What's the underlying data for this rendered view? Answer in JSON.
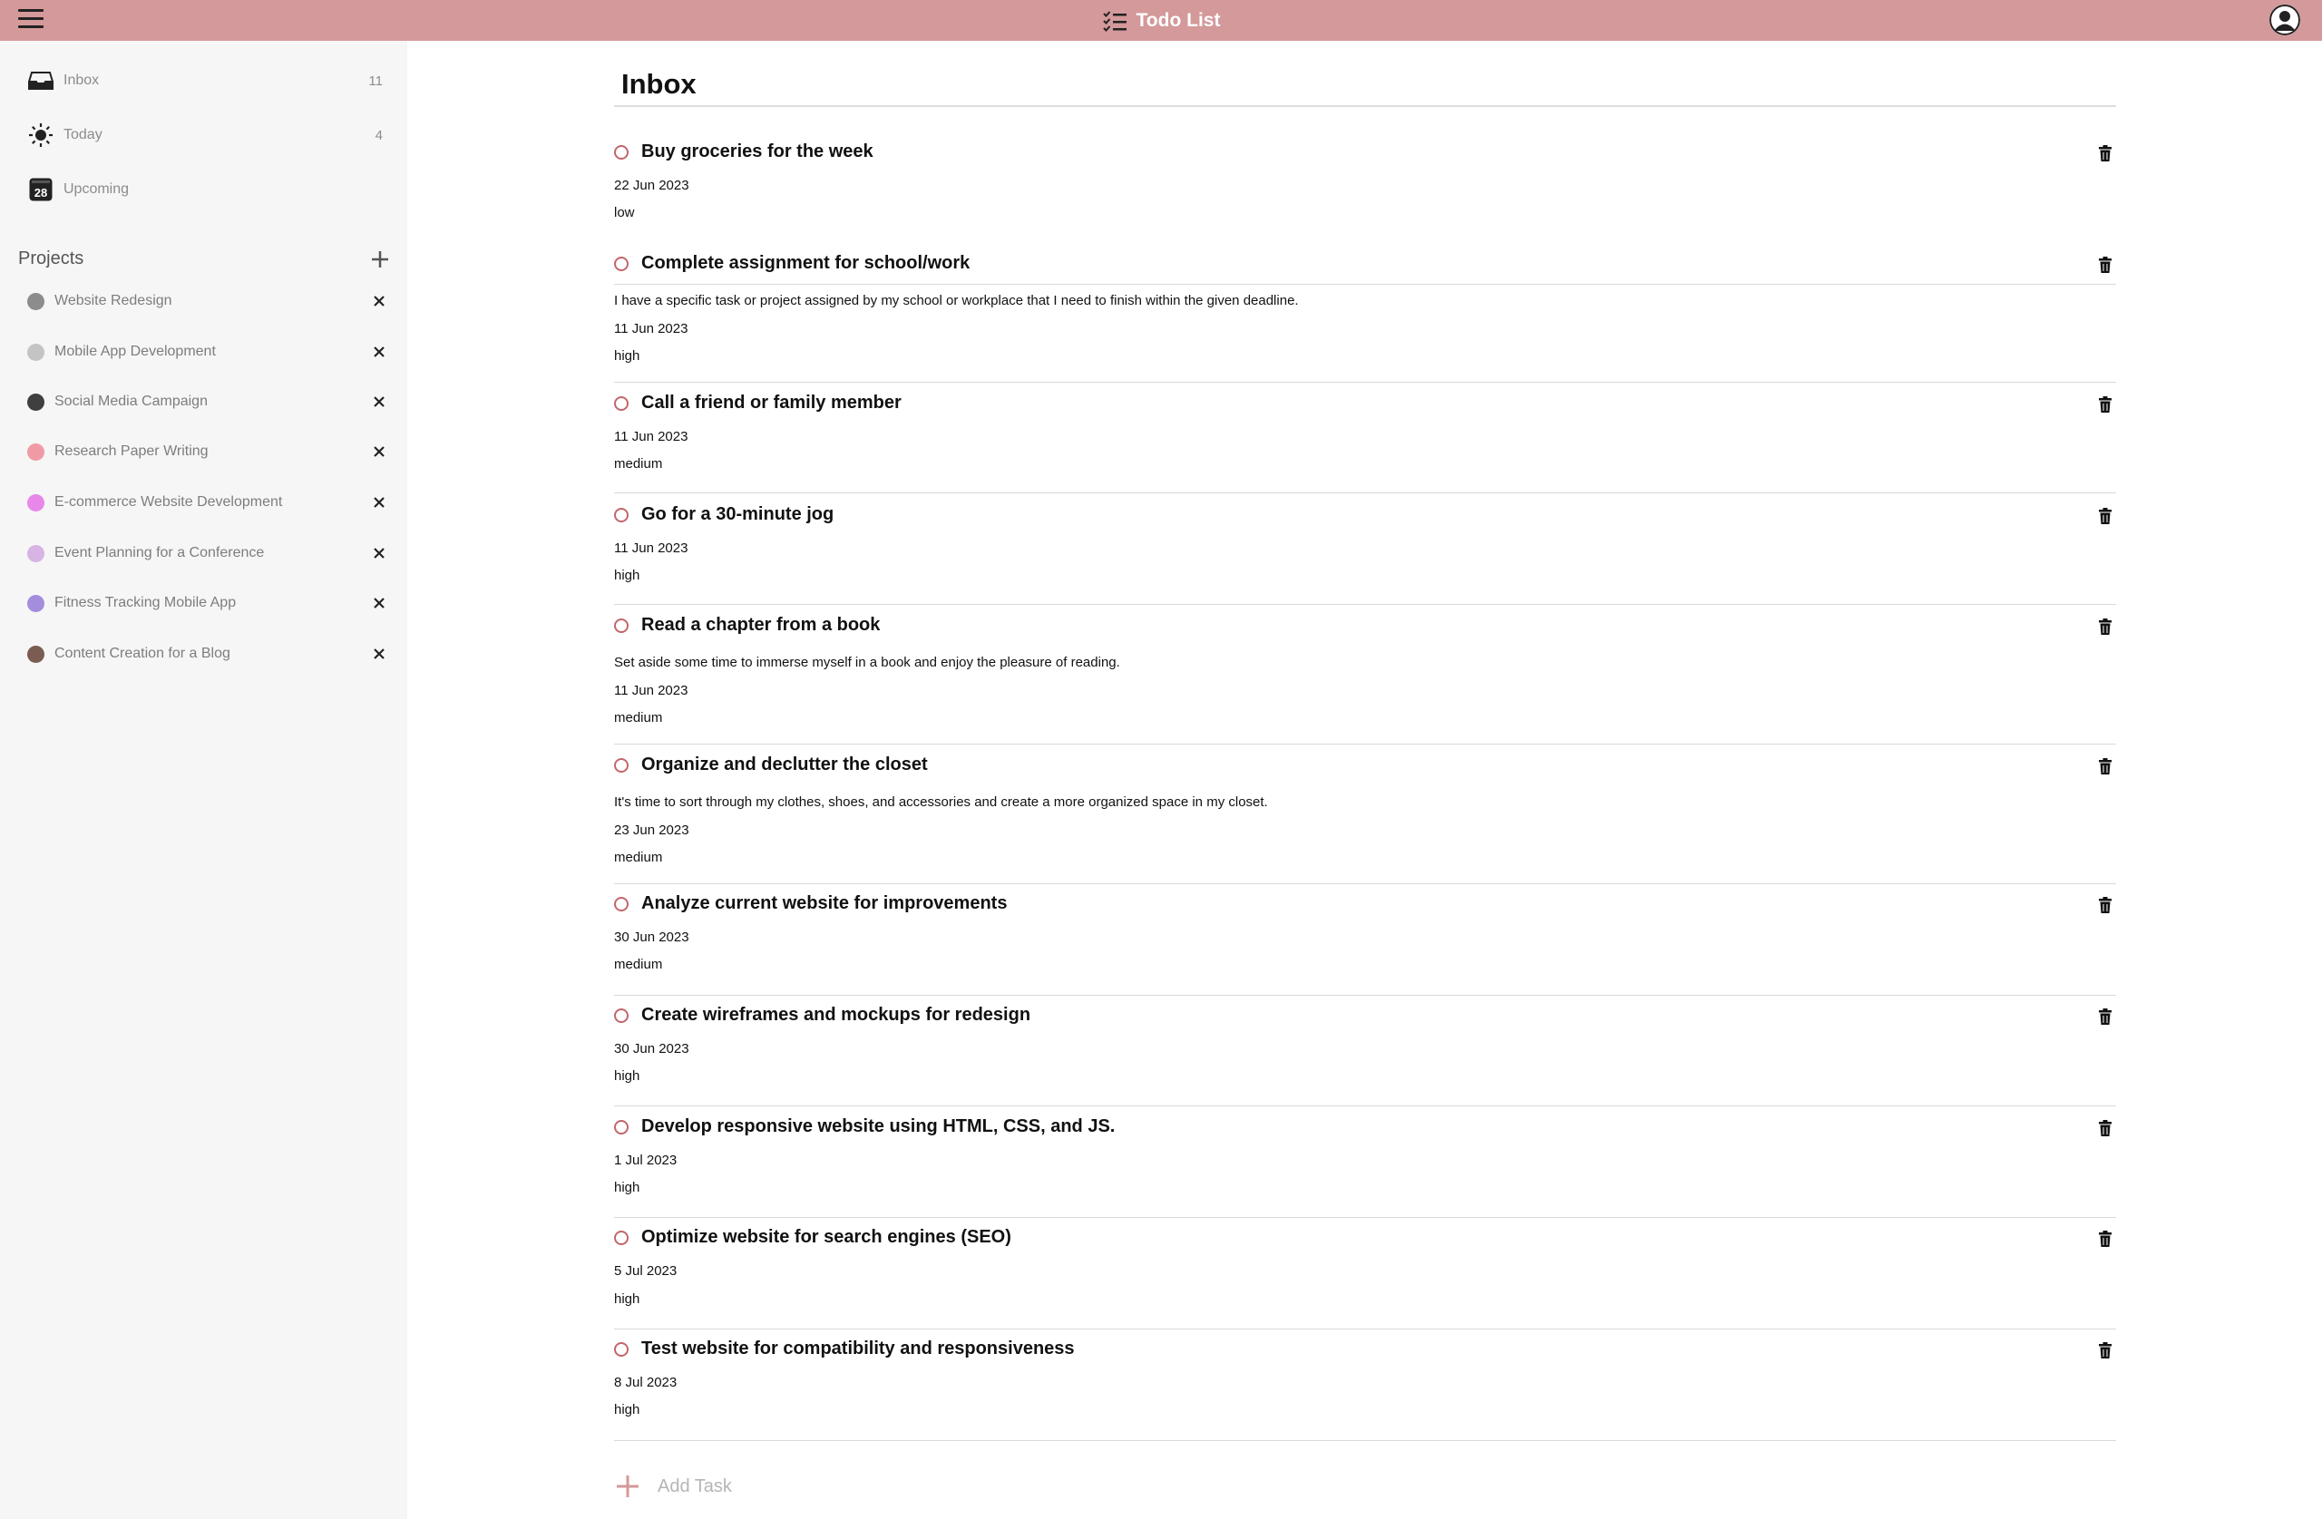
{
  "app": {
    "title": "Todo List"
  },
  "sidebar": {
    "nav": [
      {
        "label": "Inbox",
        "count": "11",
        "icon": "inbox-icon"
      },
      {
        "label": "Today",
        "count": "4",
        "icon": "sun-icon"
      },
      {
        "label": "Upcoming",
        "count": "",
        "icon": "calendar-icon",
        "calendar_day": "28"
      }
    ],
    "projects_title": "Projects",
    "projects": [
      {
        "name": "Website Redesign",
        "color": "#8c8c8c"
      },
      {
        "name": "Mobile App Development",
        "color": "#c4c4c4"
      },
      {
        "name": "Social Media Campaign",
        "color": "#3f3f3f"
      },
      {
        "name": "Research Paper Writing",
        "color": "#f09aa5"
      },
      {
        "name": "E-commerce Website Development",
        "color": "#e787e8"
      },
      {
        "name": "Event Planning for a Conference",
        "color": "#d7b4e4"
      },
      {
        "name": "Fitness Tracking Mobile App",
        "color": "#a48ddc"
      },
      {
        "name": "Content Creation for a Blog",
        "color": "#7a5c52"
      }
    ]
  },
  "main": {
    "title": "Inbox",
    "tasks": [
      {
        "title": "Buy groceries for the week",
        "description": "",
        "date": "22 Jun 2023",
        "priority": "low"
      },
      {
        "title": "Complete assignment for school/work",
        "description": "I have a specific task or project assigned by my school or workplace that I need to finish within the given deadline.",
        "date": "11 Jun 2023",
        "priority": "high"
      },
      {
        "title": "Call a friend or family member",
        "description": "",
        "date": "11 Jun 2023",
        "priority": "medium"
      },
      {
        "title": "Go for a 30-minute jog",
        "description": "",
        "date": "11 Jun 2023",
        "priority": "high"
      },
      {
        "title": "Read a chapter from a book",
        "description": "Set aside some time to immerse myself in a book and enjoy the pleasure of reading.",
        "date": "11 Jun 2023",
        "priority": "medium"
      },
      {
        "title": "Organize and declutter the closet",
        "description": "It's time to sort through my clothes, shoes, and accessories and create a more organized space in my closet.",
        "date": "23 Jun 2023",
        "priority": "medium"
      },
      {
        "title": "Analyze current website for improvements",
        "description": "",
        "date": "30 Jun 2023",
        "priority": "medium"
      },
      {
        "title": "Create wireframes and mockups for redesign",
        "description": "",
        "date": "30 Jun 2023",
        "priority": "high"
      },
      {
        "title": "Develop responsive website using HTML, CSS, and JS.",
        "description": "",
        "date": "1 Jul 2023",
        "priority": "high"
      },
      {
        "title": "Optimize website for search engines (SEO)",
        "description": "",
        "date": "5 Jul 2023",
        "priority": "high"
      },
      {
        "title": "Test website for compatibility and responsiveness",
        "description": "",
        "date": "8 Jul 2023",
        "priority": "high"
      }
    ],
    "add_task_label": "Add Task"
  },
  "colors": {
    "topbar": "#d4999a",
    "accent": "#c2666b",
    "sidebar_bg": "#f6f6f6"
  }
}
